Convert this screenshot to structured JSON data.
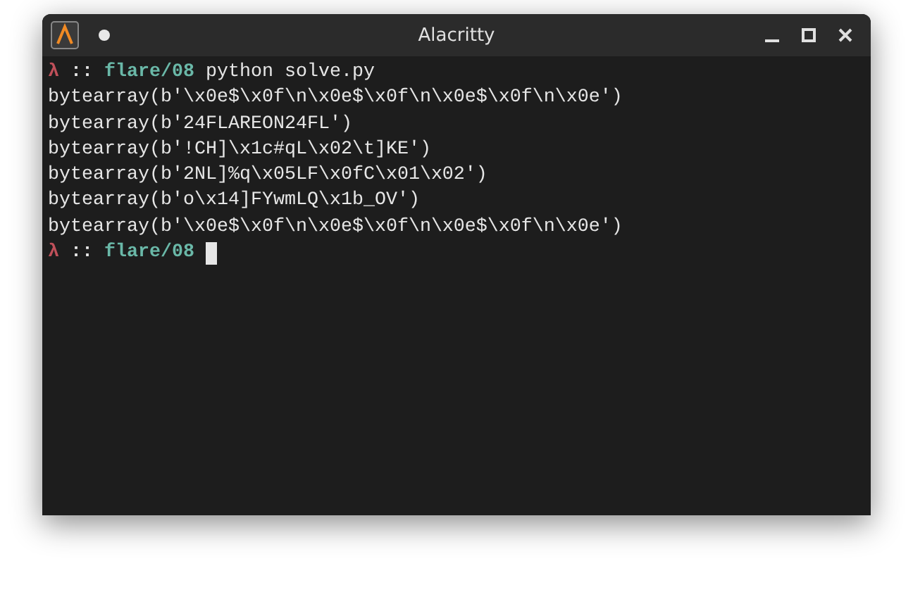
{
  "window": {
    "title": "Alacritty"
  },
  "terminal": {
    "lines": [
      {
        "kind": "prompt",
        "symbol": "λ",
        "separator": "::",
        "path": "flare/08",
        "command": "python solve.py"
      },
      {
        "kind": "output",
        "text": "bytearray(b'\\x0e$\\x0f\\n\\x0e$\\x0f\\n\\x0e$\\x0f\\n\\x0e')"
      },
      {
        "kind": "output",
        "text": "bytearray(b'24FLAREON24FL')"
      },
      {
        "kind": "output",
        "text": "bytearray(b'!CH]\\x1c#qL\\x02\\t]KE')"
      },
      {
        "kind": "output",
        "text": "bytearray(b'2NL]%q\\x05LF\\x0fC\\x01\\x02')"
      },
      {
        "kind": "output",
        "text": "bytearray(b'o\\x14]FYwmLQ\\x1b_OV')"
      },
      {
        "kind": "output",
        "text": "bytearray(b'\\x0e$\\x0f\\n\\x0e$\\x0f\\n\\x0e$\\x0f\\n\\x0e')"
      },
      {
        "kind": "prompt",
        "symbol": "λ",
        "separator": "::",
        "path": "flare/08",
        "cursor": true
      }
    ]
  }
}
